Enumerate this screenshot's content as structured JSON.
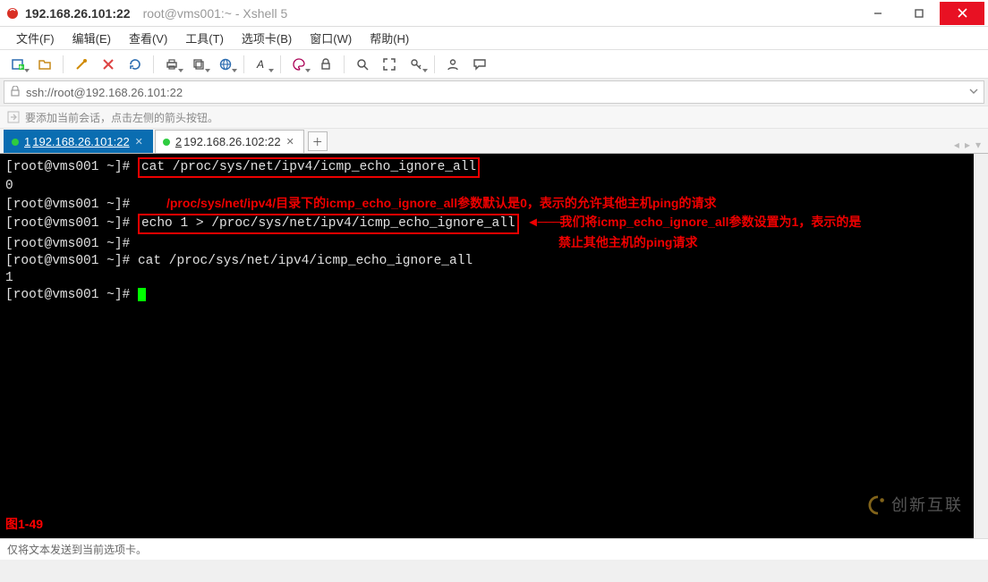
{
  "window": {
    "title_bold": "192.168.26.101:22",
    "title_path": "root@vms001:~ - Xshell 5"
  },
  "menu": {
    "items": [
      "文件(F)",
      "编辑(E)",
      "查看(V)",
      "工具(T)",
      "选项卡(B)",
      "窗口(W)",
      "帮助(H)"
    ]
  },
  "address": {
    "url": "ssh://root@192.168.26.101:22"
  },
  "hint": {
    "text": "要添加当前会话，点击左侧的箭头按钮。"
  },
  "tabs": [
    {
      "prefix": "1",
      "label": "192.168.26.101:22",
      "active": true
    },
    {
      "prefix": "2",
      "label": "192.168.26.102:22",
      "active": false
    }
  ],
  "terminal": {
    "prompt": "[root@vms001 ~]# ",
    "cmd1": "cat /proc/sys/net/ipv4/icmp_echo_ignore_all",
    "out1": "0",
    "annotation1": "/proc/sys/net/ipv4/目录下的icmp_echo_ignore_all参数默认是0，表示的允许其他主机ping的请求",
    "cmd2": "echo 1 > /proc/sys/net/ipv4/icmp_echo_ignore_all",
    "annotation2a": "我们将icmp_echo_ignore_all参数设置为1，表示的是",
    "annotation2b": "禁止其他主机的ping请求",
    "cmd3": "cat /proc/sys/net/ipv4/icmp_echo_ignore_all",
    "out3": "1",
    "figure_label": "图1-49",
    "watermark": "创新互联"
  },
  "status": {
    "text": "仅将文本发送到当前选项卡。"
  }
}
